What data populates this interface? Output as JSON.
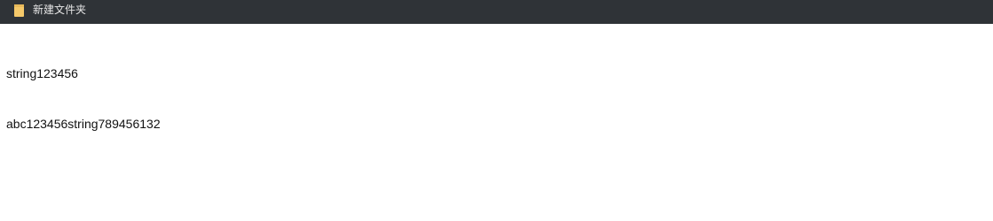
{
  "window": {
    "title": "新建文件夹",
    "icon": "folder-icon"
  },
  "editor": {
    "lines": [
      "string123456",
      "abc123456string789456132"
    ]
  },
  "colors": {
    "titlebar_bg": "#2f3337",
    "title_text": "#e6e6e6",
    "folder_icon": "#f5c96a",
    "content_bg": "#ffffff",
    "content_text": "#111111"
  }
}
